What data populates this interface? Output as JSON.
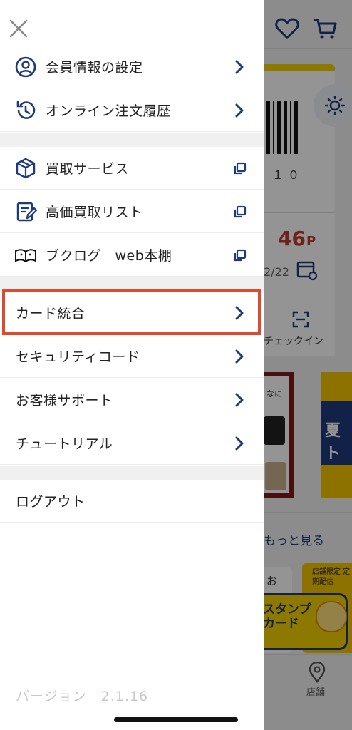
{
  "menu": {
    "close_label": "close",
    "group1": [
      {
        "label": "会員情報の設定",
        "icon": "user-circle-icon",
        "action": "chevron"
      },
      {
        "label": "オンライン注文履歴",
        "icon": "history-icon",
        "action": "chevron"
      }
    ],
    "group2": [
      {
        "label": "買取サービス",
        "icon": "box-icon",
        "action": "external"
      },
      {
        "label": "高価買取リスト",
        "icon": "edit-list-icon",
        "action": "external"
      },
      {
        "label": "ブクログ　web本棚",
        "icon": "book-icon",
        "action": "external"
      }
    ],
    "group3": [
      {
        "label": "カード統合",
        "action": "chevron"
      },
      {
        "label": "セキュリティコード",
        "action": "chevron"
      },
      {
        "label": "お客様サポート",
        "action": "chevron"
      },
      {
        "label": "チュートリアル",
        "action": "chevron"
      }
    ],
    "logout": "ログアウト",
    "version": "バージョン　2.1.16"
  },
  "background": {
    "barcode_digits": "１０",
    "points": "46",
    "points_unit": "P",
    "date_partial": "2/22",
    "checkin": "チェックイン",
    "banner_text": "夏ト",
    "more_link": "もっと見る",
    "card_top": "店舗限定 定期配信",
    "stamp_text": "スタンプ カード",
    "tab_store": "店舗",
    "snippet_ga": "なに",
    "snippet_o": "お"
  },
  "colors": {
    "navy": "#1f3a7a",
    "highlight": "#e04a2c",
    "red_points": "#c0392b"
  }
}
